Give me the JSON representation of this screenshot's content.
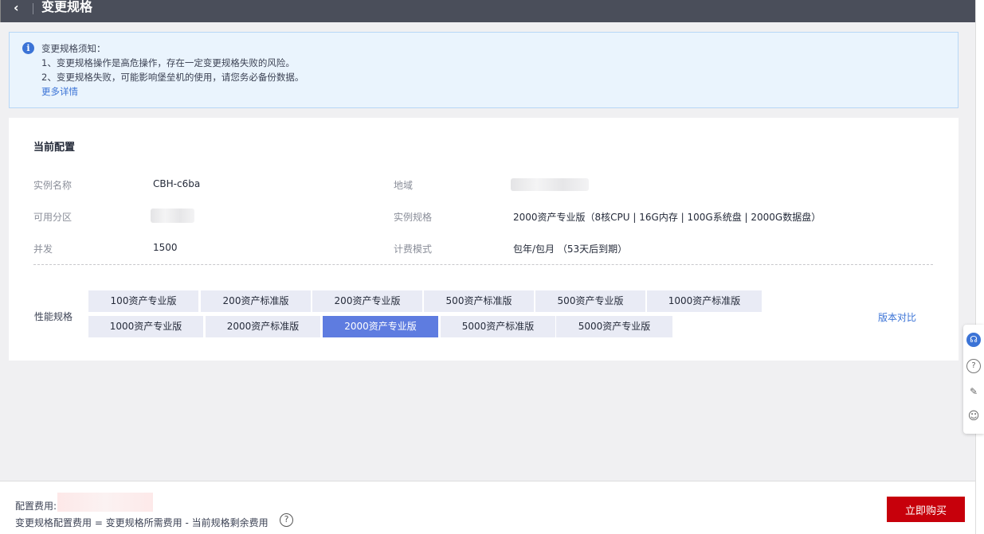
{
  "header": {
    "back_icon": "‹",
    "title": "变更规格"
  },
  "notice": {
    "title": "变更规格须知：",
    "lines": [
      "1、变更规格操作是高危操作，存在一定变更规格失败的风险。",
      "2、变更规格失败，可能影响堡垒机的使用，请您务必备份数据。"
    ],
    "more_link": "更多详情"
  },
  "config": {
    "title": "当前配置",
    "instance_name": {
      "label": "实例名称",
      "value": "CBH-c6ba"
    },
    "region": {
      "label": "地域"
    },
    "az": {
      "label": "可用分区"
    },
    "spec": {
      "label": "实例规格",
      "value": "2000资产专业版（8核CPU | 16G内存 | 100G系统盘 | 2000G数据盘）"
    },
    "concurrency": {
      "label": "并发",
      "value": "1500"
    },
    "billing": {
      "label": "计费模式",
      "value": "包年/包月 （53天后到期）"
    }
  },
  "performance": {
    "label": "性能规格",
    "row1": [
      "100资产专业版",
      "200资产标准版",
      "200资产专业版",
      "500资产标准版",
      "500资产专业版",
      "1000资产标准版"
    ],
    "row2": [
      "1000资产专业版",
      "2000资产标准版",
      "2000资产专业版",
      "5000资产标准版",
      "5000资产专业版"
    ],
    "selected": "2000资产专业版",
    "compare_link": "版本对比"
  },
  "footer": {
    "fee_label": "配置费用:",
    "formula": "变更规格配置费用 = 变更规格所需费用 - 当前规格剩余费用",
    "help_icon": "?",
    "buy_button": "立即购买"
  },
  "colors": {
    "primary": "#5e7ce0",
    "link": "#3b73d6",
    "buy": "#c7000b",
    "header": "#4a4e5a"
  }
}
